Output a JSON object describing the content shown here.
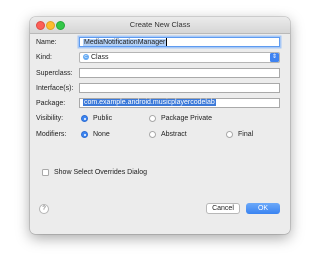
{
  "window": {
    "title": "Create New Class"
  },
  "form": {
    "name_label": "Name:",
    "name_value": "MediaNotificationManager",
    "kind_label": "Kind:",
    "kind_value": "Class",
    "kind_icon": "C",
    "superclass_label": "Superclass:",
    "superclass_value": "",
    "interfaces_label": "Interface(s):",
    "interfaces_value": "",
    "package_label": "Package:",
    "package_value": "com.example.android.musicplayercodelab",
    "visibility_label": "Visibility:",
    "visibility_options": [
      "Public",
      "Package Private"
    ],
    "visibility_selected": "Public",
    "modifiers_label": "Modifiers:",
    "modifiers_options": [
      "None",
      "Abstract",
      "Final"
    ],
    "modifiers_selected": "None",
    "overrides_label": "Show Select Overrides Dialog",
    "overrides_checked": false
  },
  "footer": {
    "help": "?",
    "cancel": "Cancel",
    "ok": "OK"
  },
  "colors": {
    "accent": "#3d86f2",
    "selection": "#b3d1f7"
  }
}
